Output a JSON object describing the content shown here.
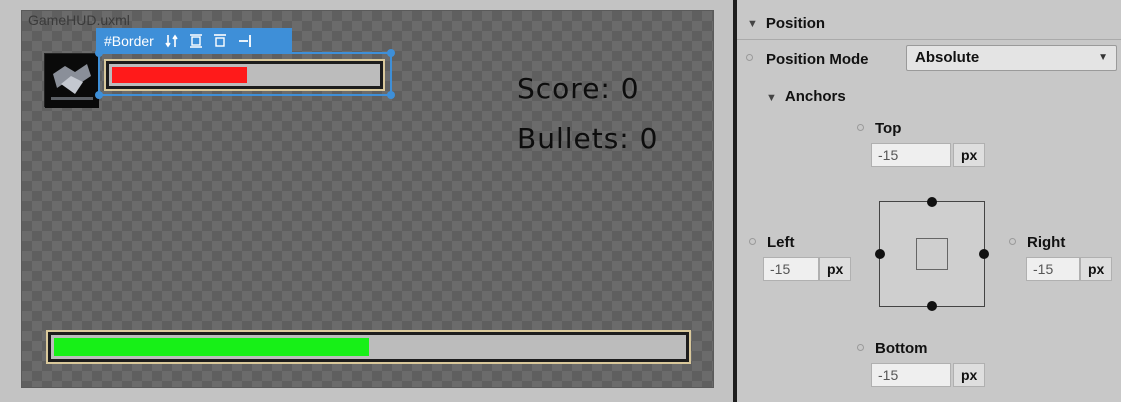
{
  "canvas": {
    "document_title": "GameHUD.uxml",
    "selection_toolbar": {
      "label": "#Border",
      "icons": [
        "sort-vertical-icon",
        "align-stretch-icon",
        "align-top-icon",
        "align-right-icon"
      ]
    },
    "health_bar": {
      "fill_fraction": 0.51,
      "fill_color": "#ff1a1a"
    },
    "bottom_bar": {
      "fill_fraction": 0.5,
      "fill_color": "#17f017"
    },
    "score_text": "Score: 0",
    "bullets_text": "Bullets: 0"
  },
  "inspector": {
    "section_title": "Position",
    "position_mode": {
      "label": "Position Mode",
      "value": "Absolute"
    },
    "anchors": {
      "title": "Anchors",
      "top": {
        "label": "Top",
        "value": "-15",
        "unit": "px"
      },
      "left": {
        "label": "Left",
        "value": "-15",
        "unit": "px"
      },
      "right": {
        "label": "Right",
        "value": "-15",
        "unit": "px"
      },
      "bottom": {
        "label": "Bottom",
        "value": "-15",
        "unit": "px"
      }
    }
  },
  "colors": {
    "selection_accent": "#3e8fd8",
    "bar_border": "#1c1c1c",
    "bar_outline": "#d9c89b"
  }
}
